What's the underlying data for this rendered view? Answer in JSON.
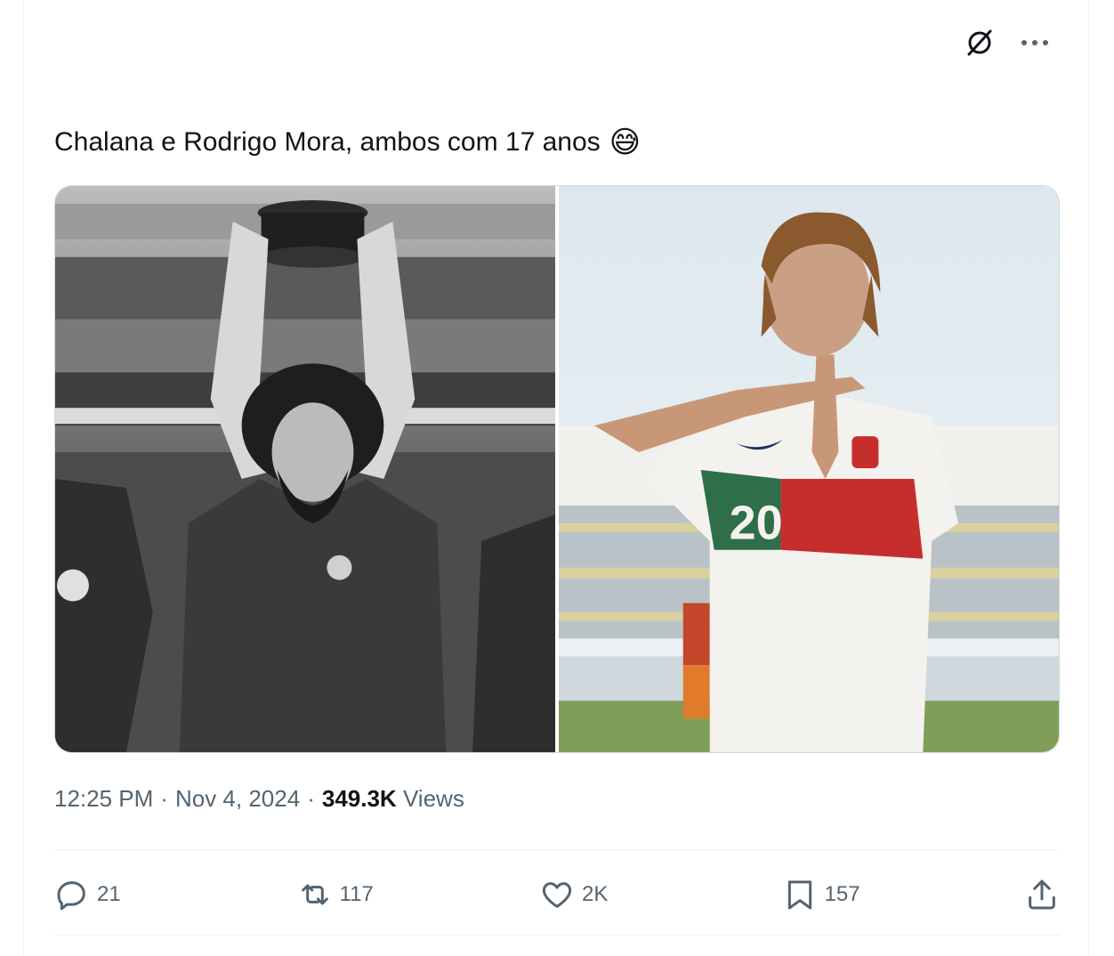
{
  "tweet": {
    "text": "Chalana e Rodrigo Mora, ambos com 17 anos",
    "emoji": "😅",
    "time": "12:25 PM",
    "separator1": "·",
    "date": "Nov 4, 2024",
    "separator2": "·",
    "views_count": "349.3K",
    "views_label": "Views"
  },
  "media": {
    "photo1": {
      "kind": "black-and-white photo of player lifting trophy"
    },
    "photo2": {
      "kind": "color photo of player in white jersey",
      "jersey_number": "20"
    }
  },
  "actions": {
    "reply": "21",
    "repost": "117",
    "like": "2K",
    "bookmark": "157"
  },
  "icons": [
    "grok-icon",
    "more-icon",
    "reply-icon",
    "repost-icon",
    "like-icon",
    "bookmark-icon",
    "share-icon"
  ],
  "colors": {
    "text": "#0f1419",
    "secondary": "#536471",
    "border": "#cfd9de"
  }
}
